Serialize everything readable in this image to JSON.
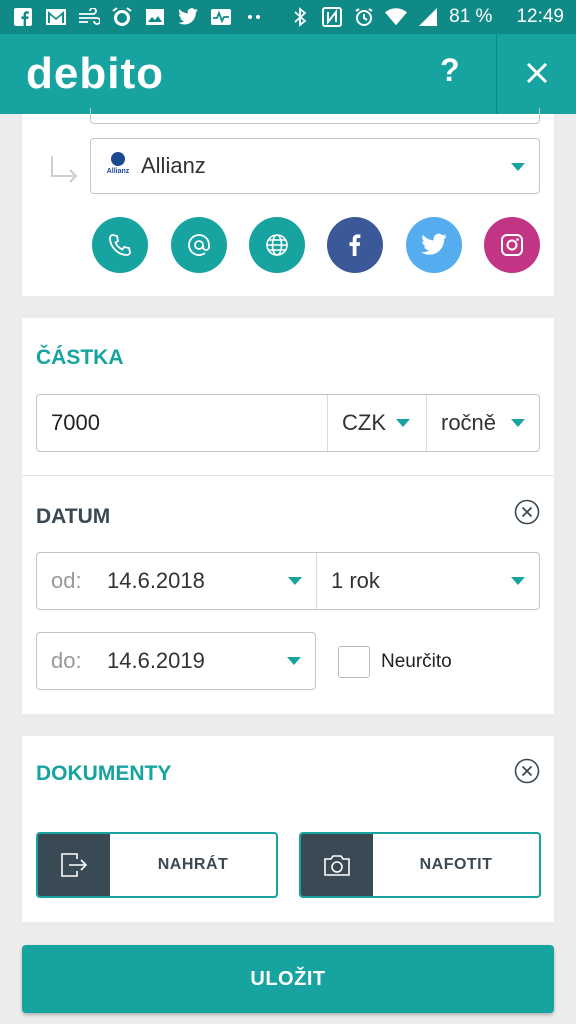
{
  "status_bar": {
    "battery": "81 %",
    "time": "12:49",
    "icons": [
      "facebook-icon",
      "gmail-icon",
      "wind-icon",
      "alarm-clock-icon",
      "image-icon",
      "twitter-icon",
      "activity-icon",
      "more-dots-icon",
      "bluetooth-icon",
      "nfc-icon",
      "alarm-icon",
      "wifi-icon",
      "signal-icon"
    ]
  },
  "app_bar": {
    "logo": "debito",
    "help_label": "?"
  },
  "insurer": {
    "selected": "Allianz",
    "logo_text": "Allianz"
  },
  "contacts": [
    {
      "name": "phone-icon",
      "color": "#17a3a0"
    },
    {
      "name": "email-icon",
      "color": "#17a3a0"
    },
    {
      "name": "web-icon",
      "color": "#17a3a0"
    },
    {
      "name": "facebook-icon",
      "color": "#3b5998"
    },
    {
      "name": "twitter-icon",
      "color": "#55acee"
    },
    {
      "name": "instagram-icon",
      "color": "#c13584"
    }
  ],
  "amount": {
    "title": "ČÁSTKA",
    "value": "7000",
    "currency": "CZK",
    "period": "ročně"
  },
  "date": {
    "title": "DATUM",
    "from_prefix": "od:",
    "from_value": "14.6.2018",
    "duration": "1 rok",
    "to_prefix": "do:",
    "to_value": "14.6.2019",
    "indefinite_label": "Neurčito",
    "indefinite_checked": false
  },
  "documents": {
    "title": "DOKUMENTY",
    "upload_label": "NAHRÁT",
    "photo_label": "NAFOTIT"
  },
  "save_label": "ULOŽIT",
  "colors": {
    "primary": "#17a3a0",
    "status_bar": "#0f8a87",
    "dark": "#3a4a55",
    "background": "#ececec"
  }
}
